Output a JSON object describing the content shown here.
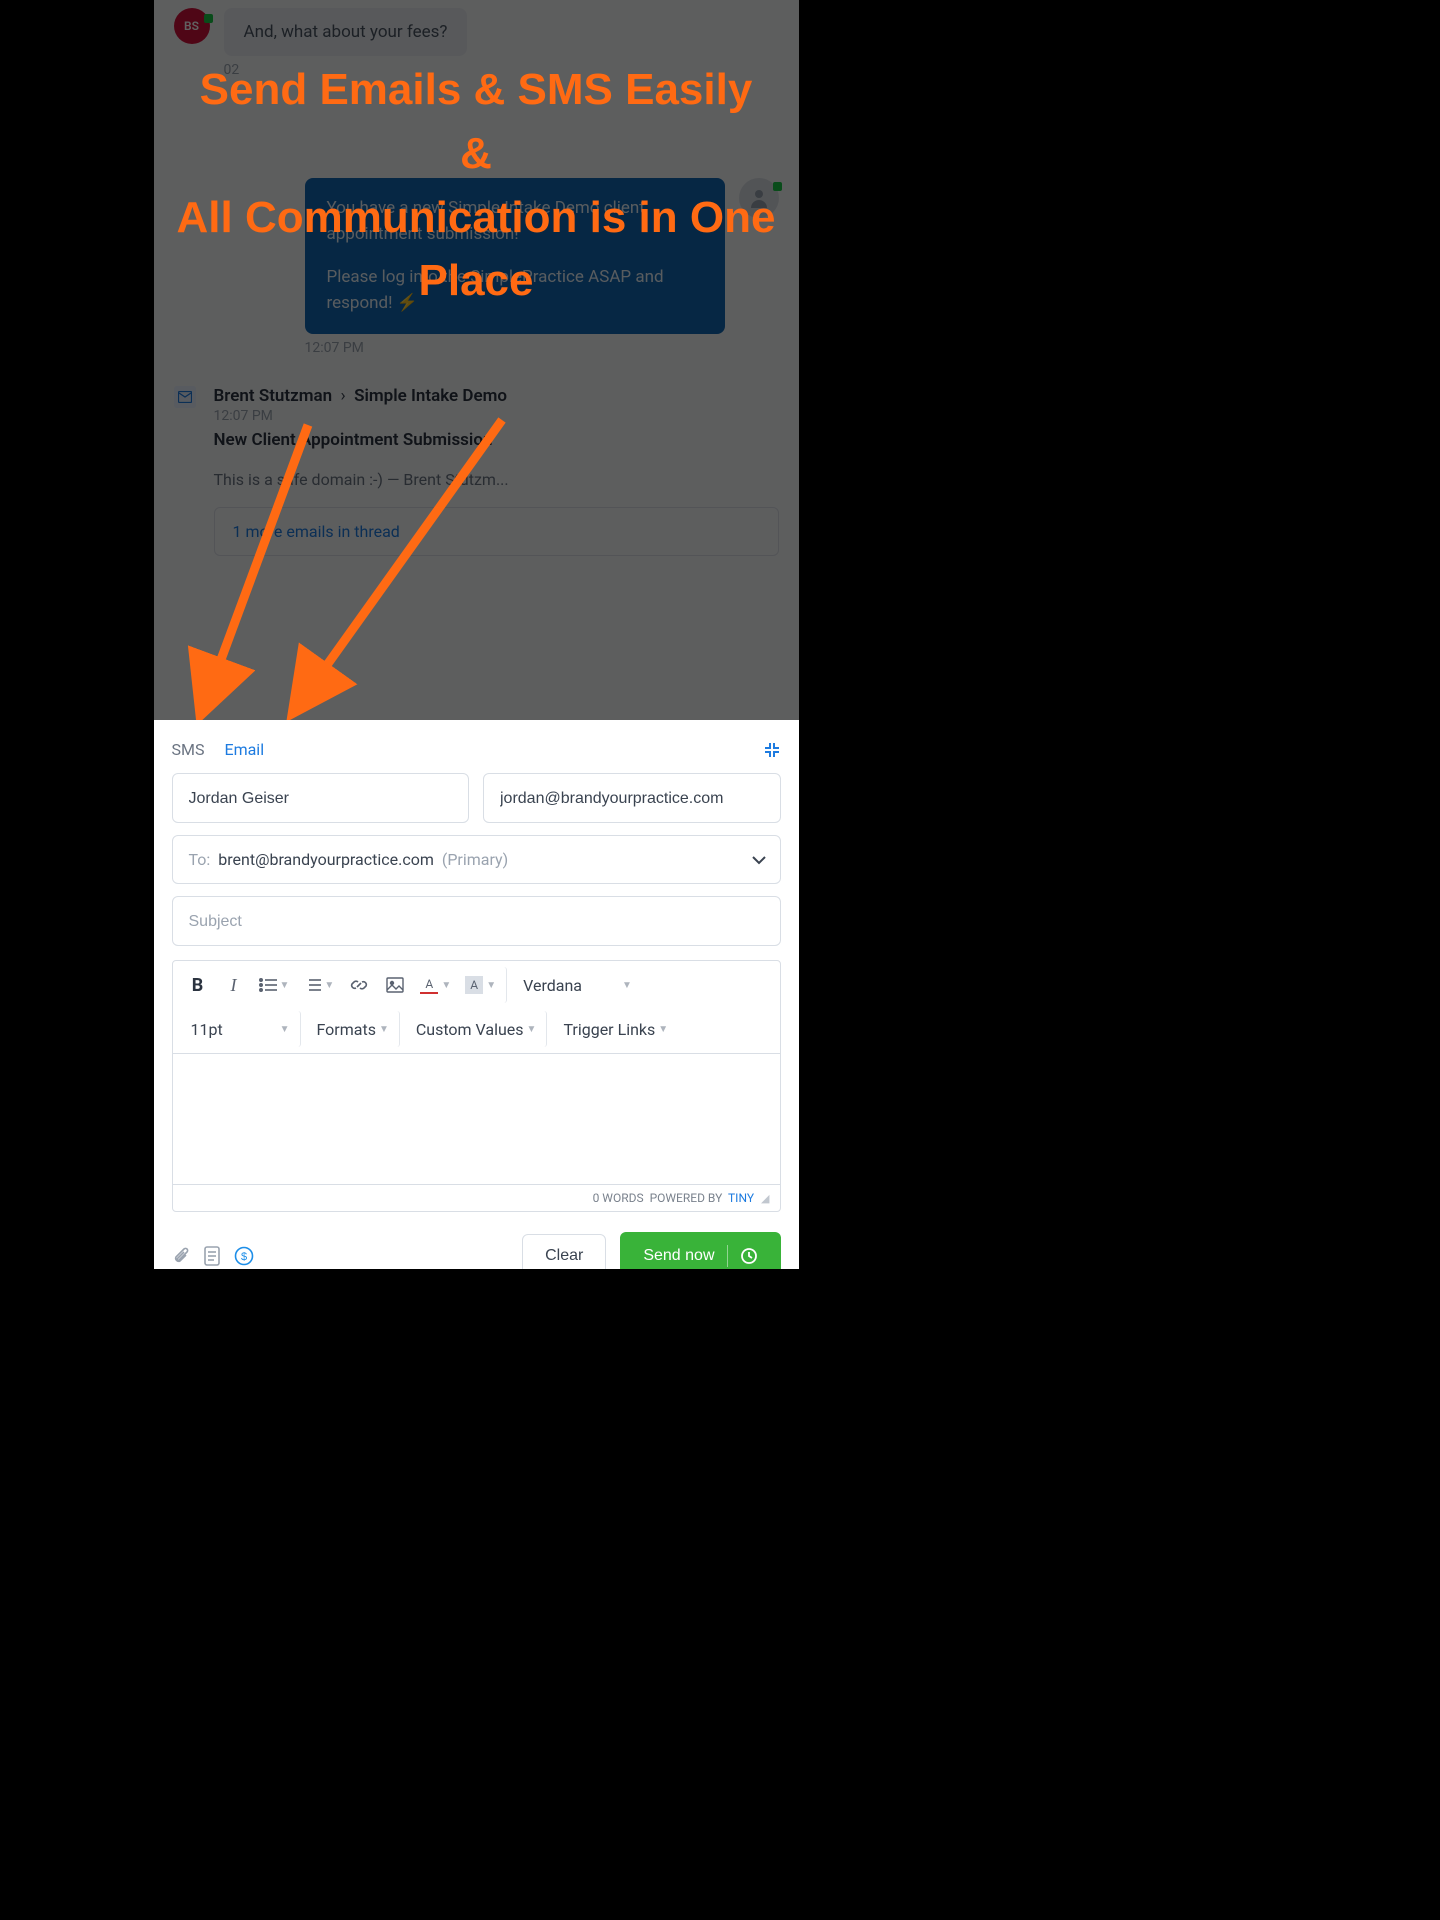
{
  "annotation": {
    "line1": "Send Emails & SMS Easily",
    "line2": "&",
    "line3": "All Communication is in One Place"
  },
  "chat": {
    "sender_initials": "BS",
    "inbound_message": "And, what about your fees?",
    "inbound_time": "02",
    "outbound_message_l1": "You have a new Simple Intake Demo client appointment submission!",
    "outbound_message_l2": "Please log into the SimplePractice ASAP and respond! ⚡",
    "outbound_time": "12:07 PM"
  },
  "email_card": {
    "from": "Brent Stutzman",
    "to": "Simple Intake Demo",
    "time": "12:07 PM",
    "subject": "New Client Appointment Submission",
    "snippet": "This is a safe domain :-) — Brent Stutzm...",
    "thread_more": "1 more emails in thread"
  },
  "composer": {
    "tabs": {
      "sms": "SMS",
      "email": "Email"
    },
    "from_name": "Jordan Geiser",
    "from_email": "jordan@brandyourpractice.com",
    "to_label": "To:",
    "to_value": "brent@brandyourpractice.com",
    "to_primary": "(Primary)",
    "subject_placeholder": "Subject",
    "toolbar": {
      "font_family": "Verdana",
      "font_size": "11pt",
      "formats": "Formats",
      "custom_values": "Custom Values",
      "trigger_links": "Trigger Links"
    },
    "footer_words": "0 WORDS",
    "footer_powered": "POWERED BY",
    "footer_brand": "TINY",
    "actions": {
      "clear": "Clear",
      "send": "Send now"
    }
  }
}
